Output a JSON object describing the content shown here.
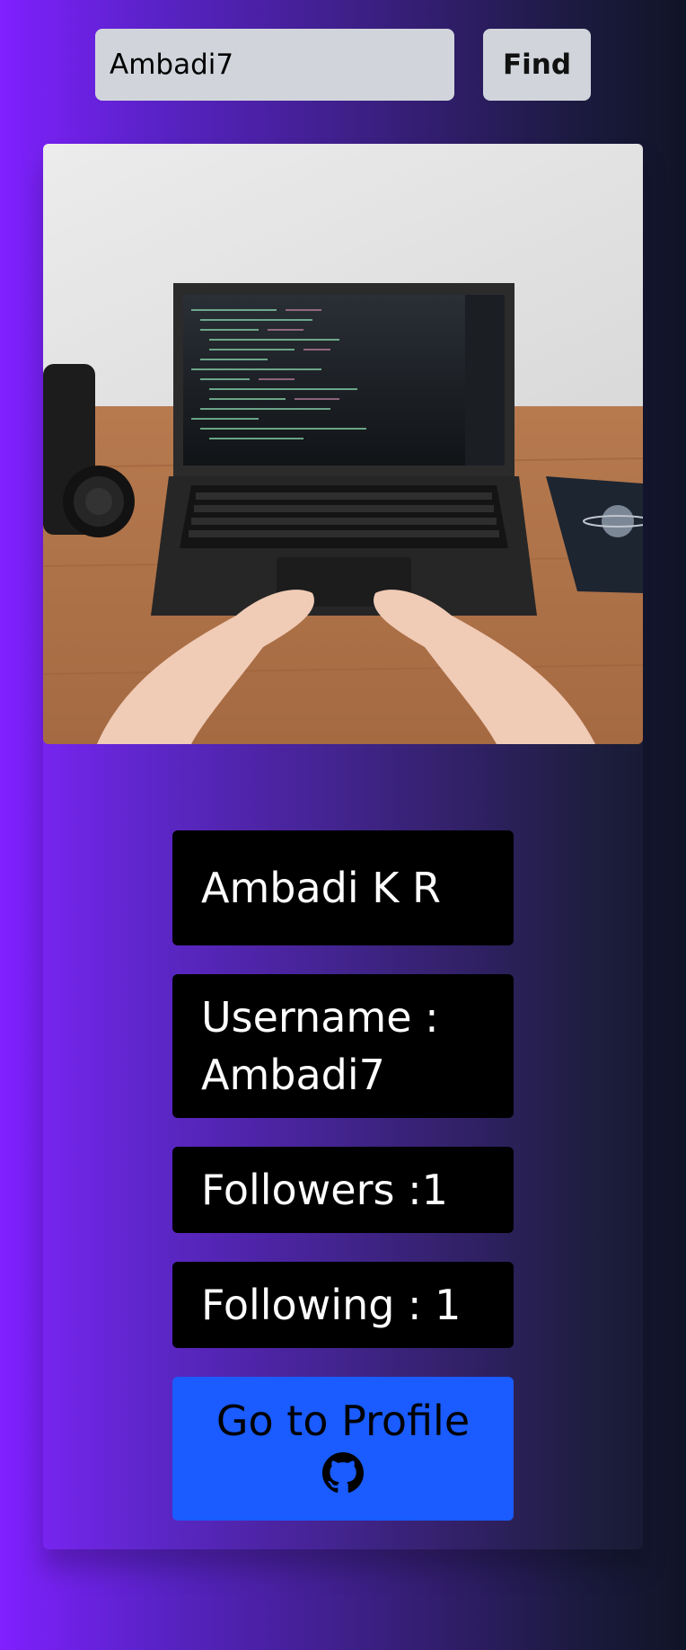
{
  "search": {
    "value": "Ambadi7",
    "button_label": "Find"
  },
  "profile": {
    "photo_icon": "laptop-coding-photo",
    "name": "Ambadi K R",
    "username_label": "Username :",
    "username": "Ambadi7",
    "followers_text": "Followers :1",
    "following_text": "Following : 1",
    "button_label": "Go to Profile",
    "button_icon": "github-icon"
  },
  "colors": {
    "profile_button": "#1a5cff",
    "info_box": "#000000",
    "search_bg": "#d1d5db"
  }
}
